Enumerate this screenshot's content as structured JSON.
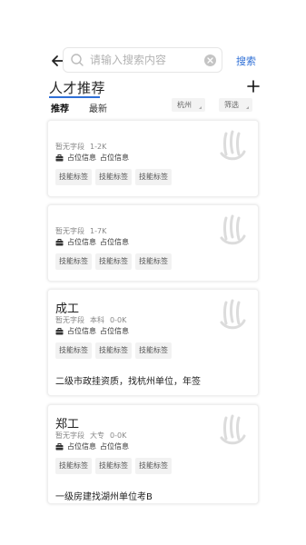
{
  "search": {
    "placeholder": "请输入搜索内容",
    "button_label": "搜索"
  },
  "header": {
    "title": "人才推荐"
  },
  "tabs": [
    {
      "label": "推荐",
      "active": true
    },
    {
      "label": "最新",
      "active": false
    }
  ],
  "filters": [
    {
      "label": "杭州"
    },
    {
      "label": "筛选"
    }
  ],
  "cards": [
    {
      "name": "",
      "meta": [
        "暂无字段",
        "1-2K"
      ],
      "info": [
        "占位信息",
        "占位信息"
      ],
      "tags": [
        "技能标签",
        "技能标签",
        "技能标签"
      ],
      "desc": ""
    },
    {
      "name": "",
      "meta": [
        "暂无字段",
        "1-7K"
      ],
      "info": [
        "占位信息",
        "占位信息"
      ],
      "tags": [
        "技能标签",
        "技能标签",
        "技能标签"
      ],
      "desc": ""
    },
    {
      "name": "成工",
      "meta": [
        "暂无字段",
        "本科",
        "0-0K"
      ],
      "info": [
        "占位信息",
        "占位信息"
      ],
      "tags": [
        "技能标签",
        "技能标签",
        "技能标签"
      ],
      "desc": "二级市政挂资质，找杭州单位，年签"
    },
    {
      "name": "郑工",
      "meta": [
        "暂无字段",
        "大专",
        "0-0K"
      ],
      "info": [
        "占位信息",
        "占位信息"
      ],
      "tags": [
        "技能标签",
        "技能标签",
        "技能标签"
      ],
      "desc": "一级房建找湖州单位考B"
    }
  ],
  "colors": {
    "accent": "#2f6fd6",
    "tag_bg": "#f2f2f2",
    "logo": "#d9d9d9"
  },
  "icons": {
    "back": "arrow-left-icon",
    "search": "search-icon",
    "clear": "clear-icon",
    "add": "plus-icon",
    "briefcase": "briefcase-icon",
    "logo": "brand-logo-icon"
  }
}
